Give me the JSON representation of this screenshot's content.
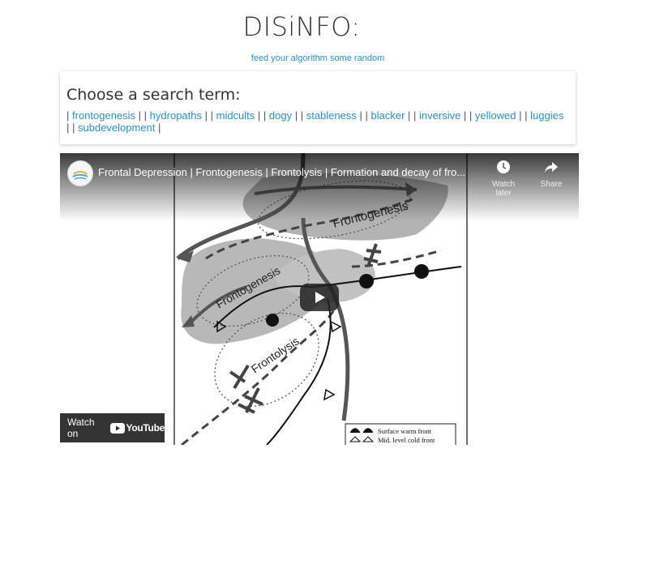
{
  "header": {
    "title": "DISiNFO:",
    "subtitle": "feed your algorithm some random"
  },
  "search": {
    "heading": "Choose a search term:",
    "terms": [
      "frontogenesis",
      "hydropaths",
      "midcults",
      "dogy",
      "stableness",
      "blacker",
      "inversive",
      "yellowed",
      "luggies",
      "subdevelopment"
    ],
    "separator": "|"
  },
  "video": {
    "title": "Frontal Depression | Frontogenesis | Frontolysis | Formation and decay of fro...",
    "watch_later_label": "Watch later",
    "share_label": "Share",
    "watch_on_label": "Watch on",
    "youtube_label": "YouTube",
    "thumbnail_labels": {
      "frontogenesis_top": "Frontogenesis",
      "frontogenesis_left": "Frontogenesis",
      "frontolysis": "Frontolysis",
      "legend_warm": "Surface warm front",
      "legend_cold": "Mid. level cold front"
    }
  }
}
